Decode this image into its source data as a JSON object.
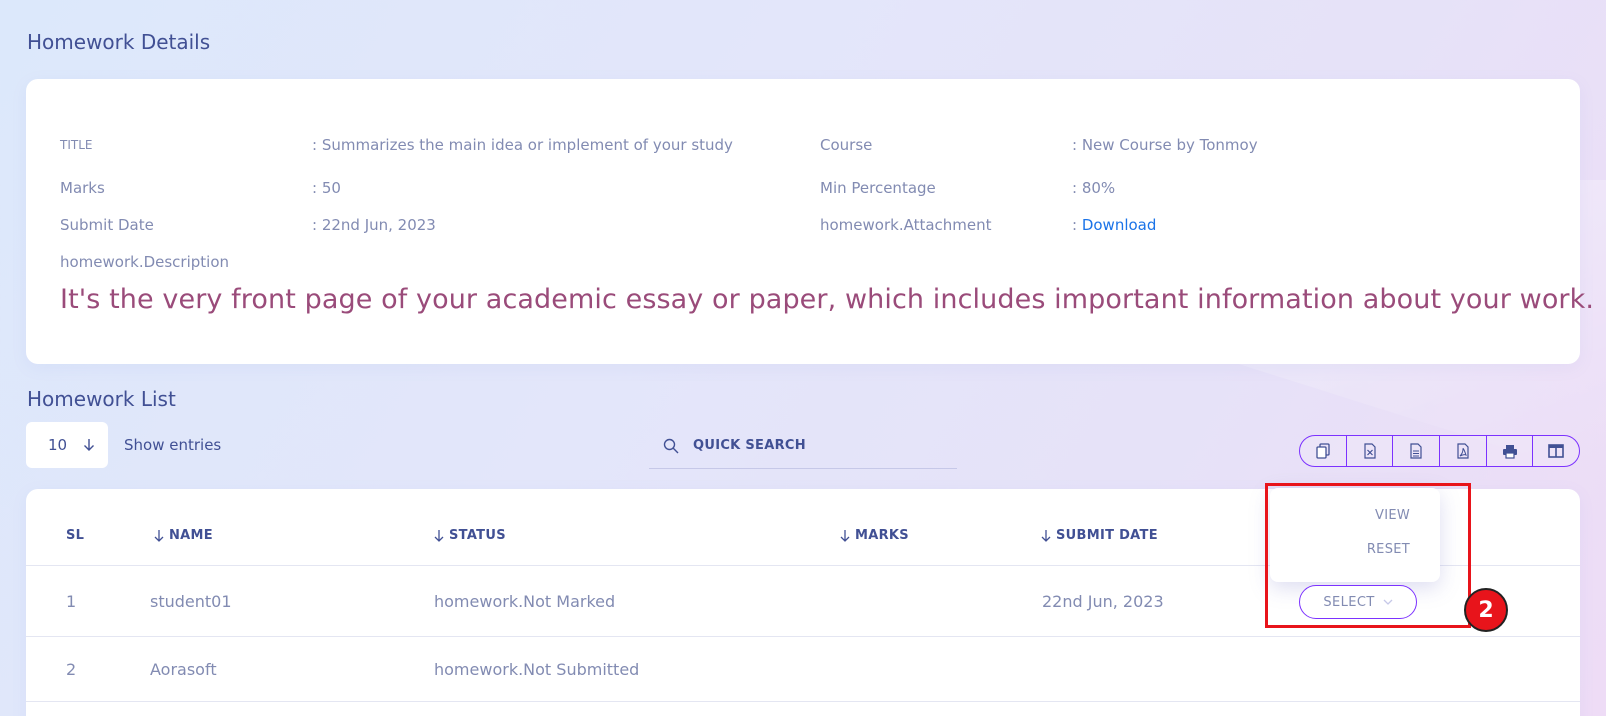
{
  "details_title": "Homework Details",
  "details": {
    "title_label": "TITLE",
    "title_value": ": Summarizes the main idea or implement of your study",
    "course_label": "Course",
    "course_value": ": New Course by Tonmoy",
    "marks_label": "Marks",
    "marks_value": ": 50",
    "min_pct_label": "Min Percentage",
    "min_pct_value": ": 80%",
    "submit_label": "Submit Date",
    "submit_value": ": 22nd Jun, 2023",
    "attach_label": "homework.Attachment",
    "attach_prefix": ": ",
    "attach_link": "Download",
    "desc_label": "homework.Description",
    "desc_value": "It's the very front page of your academic essay or paper, which includes important information about your work."
  },
  "list_title": "Homework List",
  "entries": {
    "value": "10",
    "label": "Show entries"
  },
  "search": {
    "placeholder": "QUICK SEARCH"
  },
  "toolbar": {
    "icons": [
      "copy-icon",
      "excel-icon",
      "csv-icon",
      "pdf-icon",
      "print-icon",
      "columns-icon"
    ]
  },
  "table": {
    "headers": {
      "sl": "SL",
      "name": "NAME",
      "status": "STATUS",
      "marks": "MARKS",
      "submit_date": "SUBMIT DATE"
    },
    "rows": [
      {
        "sl": "1",
        "name": "student01",
        "status": "homework.Not Marked",
        "marks": "",
        "submit_date": "22nd Jun, 2023",
        "action": "SELECT"
      },
      {
        "sl": "2",
        "name": "Aorasoft",
        "status": "homework.Not Submitted",
        "marks": "",
        "submit_date": ""
      }
    ]
  },
  "dropdown": {
    "items": [
      "VIEW",
      "RESET"
    ]
  },
  "annotation": {
    "badge": "2",
    "color": "#e8141b"
  },
  "colors": {
    "accent": "#7c32ff",
    "text": "#415094",
    "muted": "#828bb2",
    "link": "#1a73e8",
    "description": "#9a4b7a"
  }
}
